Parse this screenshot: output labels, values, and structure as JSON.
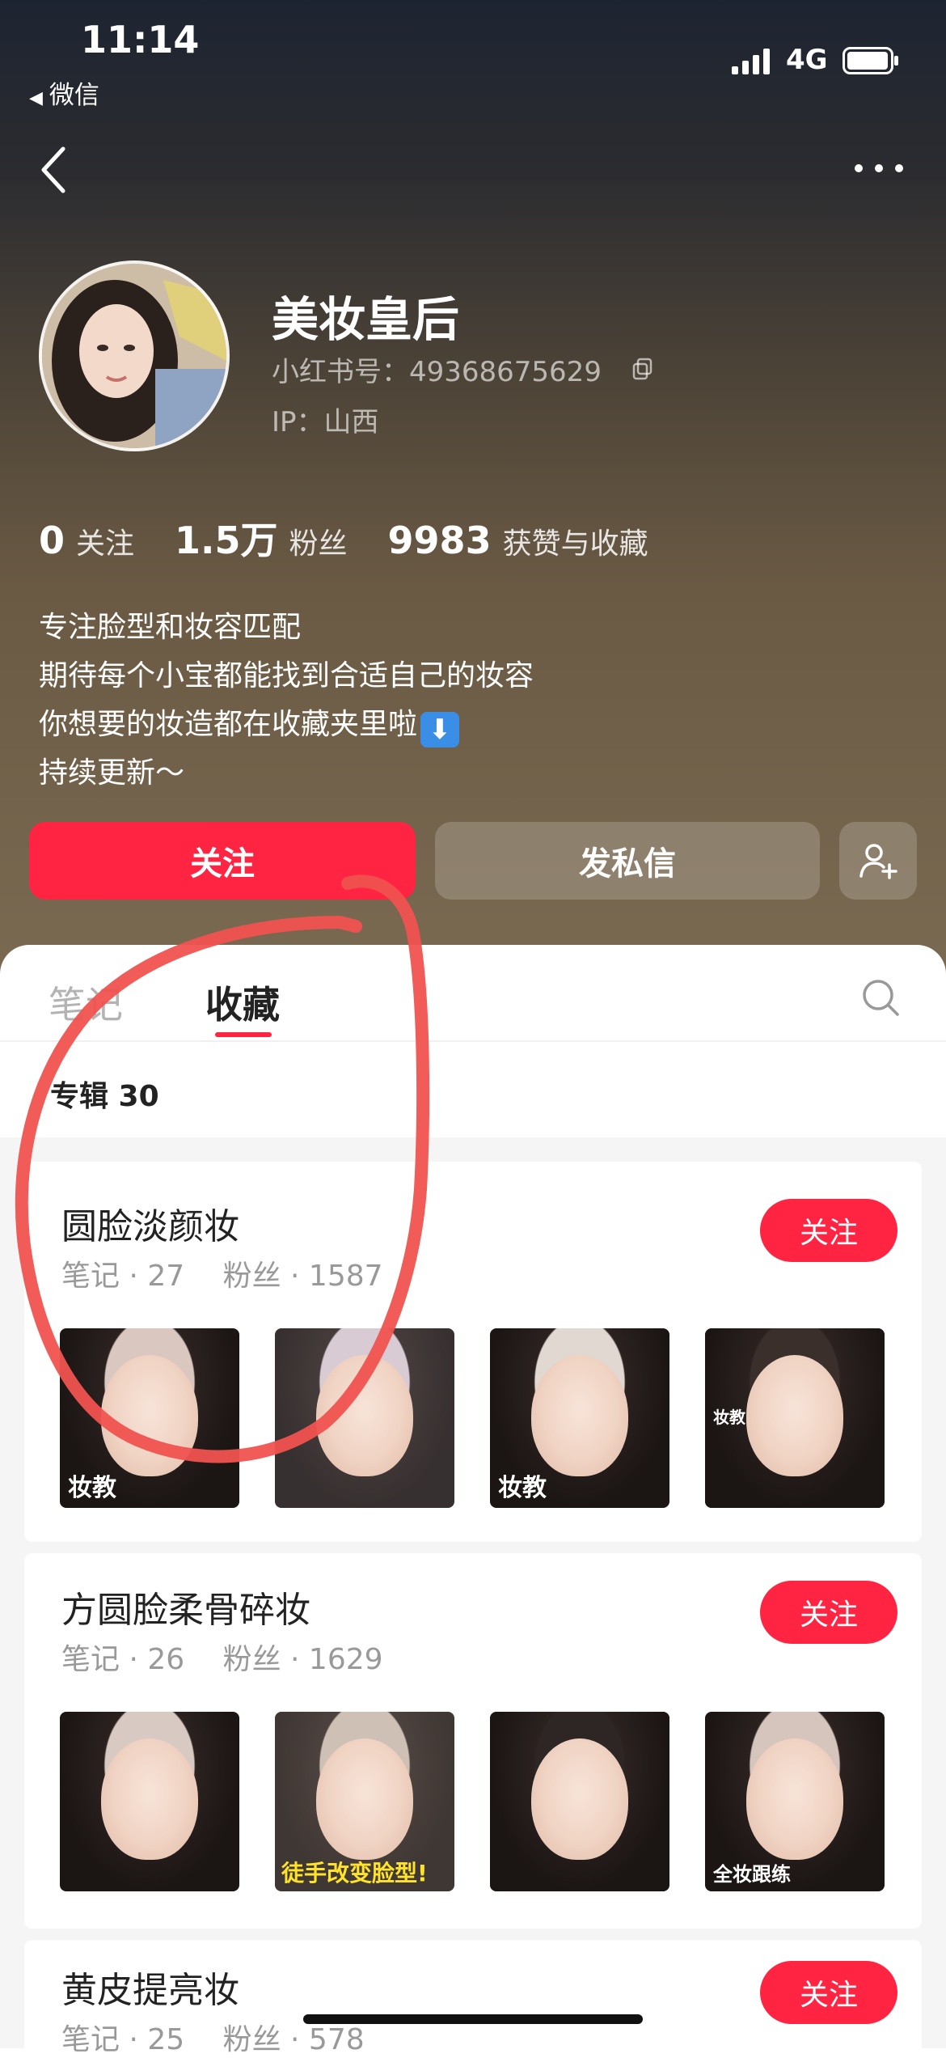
{
  "status_bar": {
    "time": "11:14",
    "back_app": "微信",
    "network": "4G"
  },
  "profile": {
    "name": "美妆皇后",
    "red_id": "小红书号：49368675629",
    "ip": "IP：山西",
    "stats": [
      {
        "value": "0",
        "label": "关注"
      },
      {
        "value": "1.5万",
        "label": "粉丝"
      },
      {
        "value": "9983",
        "label": "获赞与收藏"
      }
    ],
    "bio": [
      "专注脸型和妆容匹配",
      "期待每个小宝都能找到合适自己的妆容",
      "你想要的妆造都在收藏夹里啦",
      "持续更新～"
    ]
  },
  "actions": {
    "follow": "关注",
    "message": "发私信"
  },
  "tabs": [
    {
      "label": "笔记"
    },
    {
      "label": "收藏"
    }
  ],
  "album_count": "专辑 30",
  "albums": [
    {
      "title": "圆脸淡颜妆",
      "meta": "笔记 · 27　 粉丝 · 1587",
      "follow": "关注",
      "thumb_captions": [
        "妆教",
        "",
        "妆教",
        "妆教"
      ]
    },
    {
      "title": "方圆脸柔骨碎妆",
      "meta": "笔记 · 26　 粉丝 · 1629",
      "follow": "关注",
      "thumb_captions": [
        "",
        "徒手改变脸型!",
        "",
        "全妆跟练"
      ]
    },
    {
      "title": "黄皮提亮妆",
      "meta": "笔记 · 25　 粉丝 · 578",
      "follow": "关注"
    }
  ],
  "colors": {
    "accent": "#ff2442",
    "annotation": "#f0524f"
  }
}
